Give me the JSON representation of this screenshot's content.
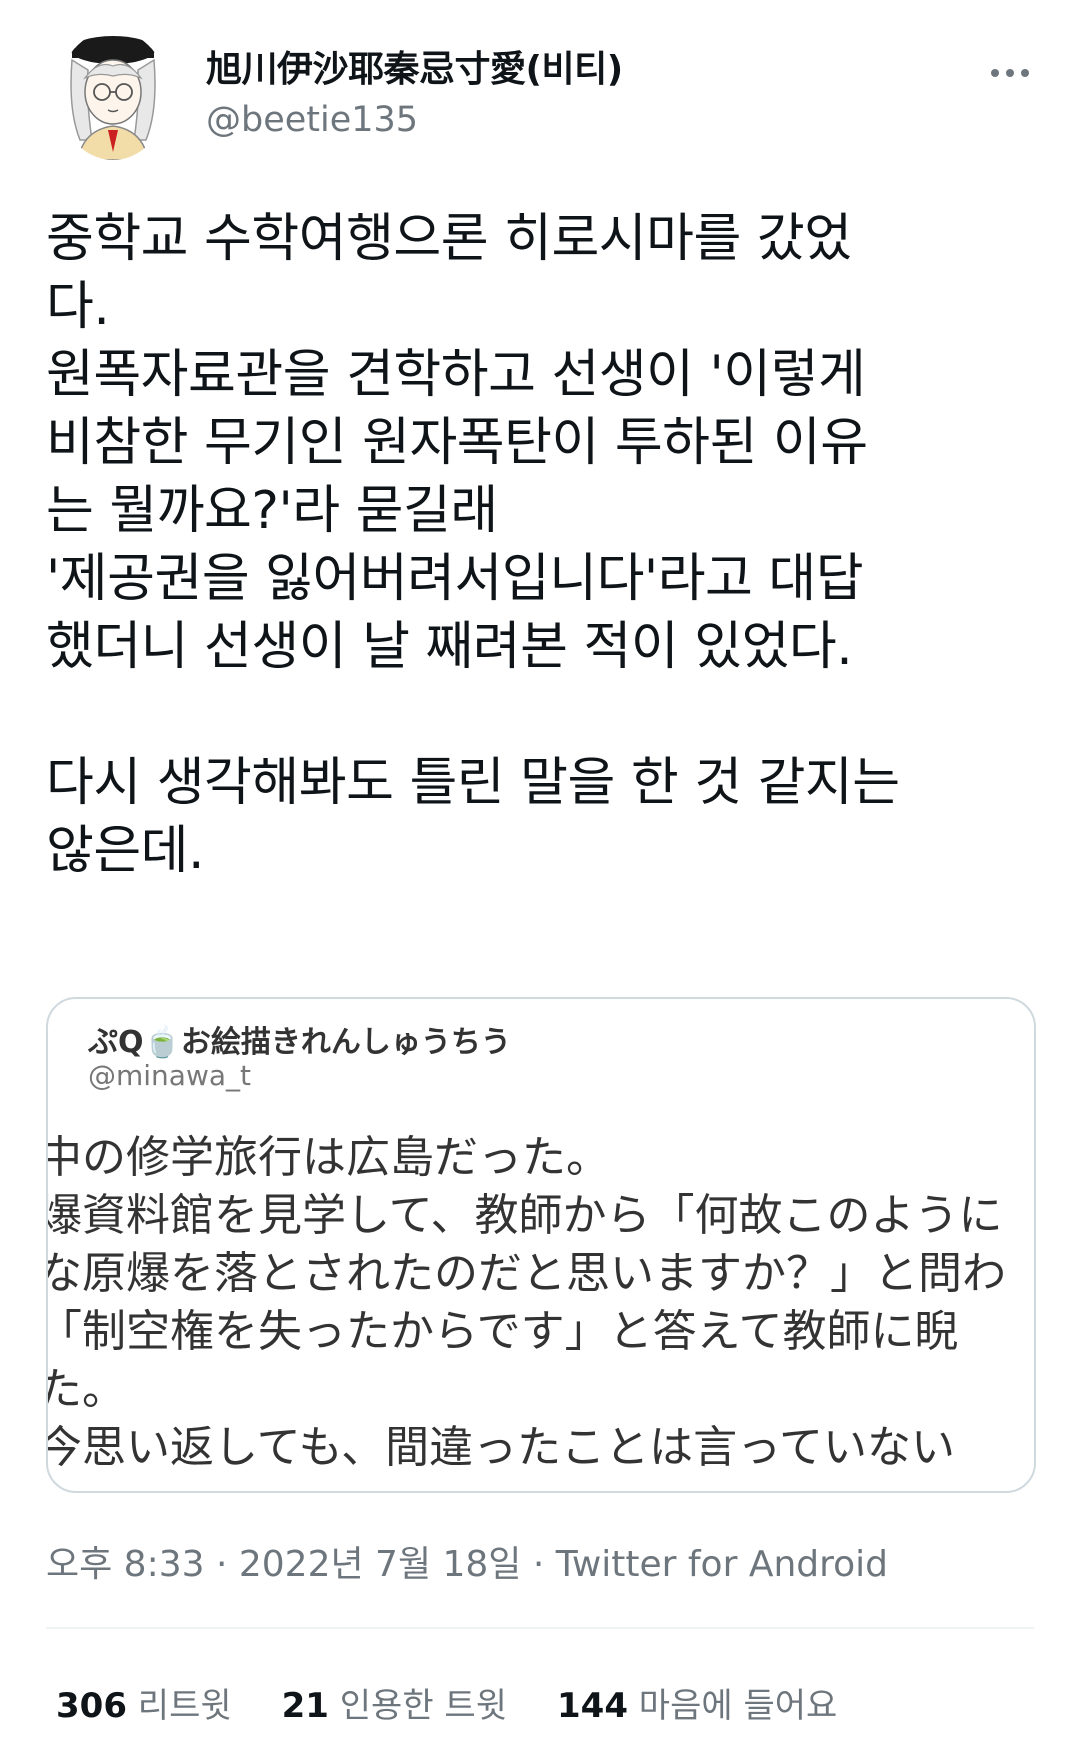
{
  "author": {
    "display_name": "旭川伊沙耶秦忌寸愛(비티)",
    "handle": "@beetie135",
    "avatar_icon": "anime-girl-avatar-icon"
  },
  "tweet": {
    "text": "중학교 수학여행으론 히로시마를 갔었\n다.\n원폭자료관을 견학하고 선생이 '이렇게\n비참한 무기인 원자폭탄이 투하된 이유\n는 뭘까요?'라 묻길래\n'제공권을 잃어버려서입니다'라고 대답\n했더니 선생이 날 째려본 적이 있었다.\n\n다시 생각해봐도 틀린 말을 한 것 같지는\n않은데.",
    "timestamp": "오후 8:33 · 2022년 7월 18일",
    "source": "Twitter for Android",
    "separator": " · "
  },
  "quote": {
    "display_name": "ぷQ🍵お絵描きれんしゅうちう",
    "handle": "@minawa_t",
    "lines": [
      "中の修学旅行は広島だった。",
      "爆資料館を見学して、教師から「何故このように",
      "な原爆を落とされたのだと思いますか？」と問わ",
      "「制空権を失ったからです」と答えて教師に睨",
      "た。",
      "今思い返しても、間違ったことは言っていない"
    ]
  },
  "stats": [
    {
      "count": "306",
      "label": "리트윗"
    },
    {
      "count": "21",
      "label": "인용한 트윗"
    },
    {
      "count": "144",
      "label": "마음에 들어요"
    }
  ]
}
